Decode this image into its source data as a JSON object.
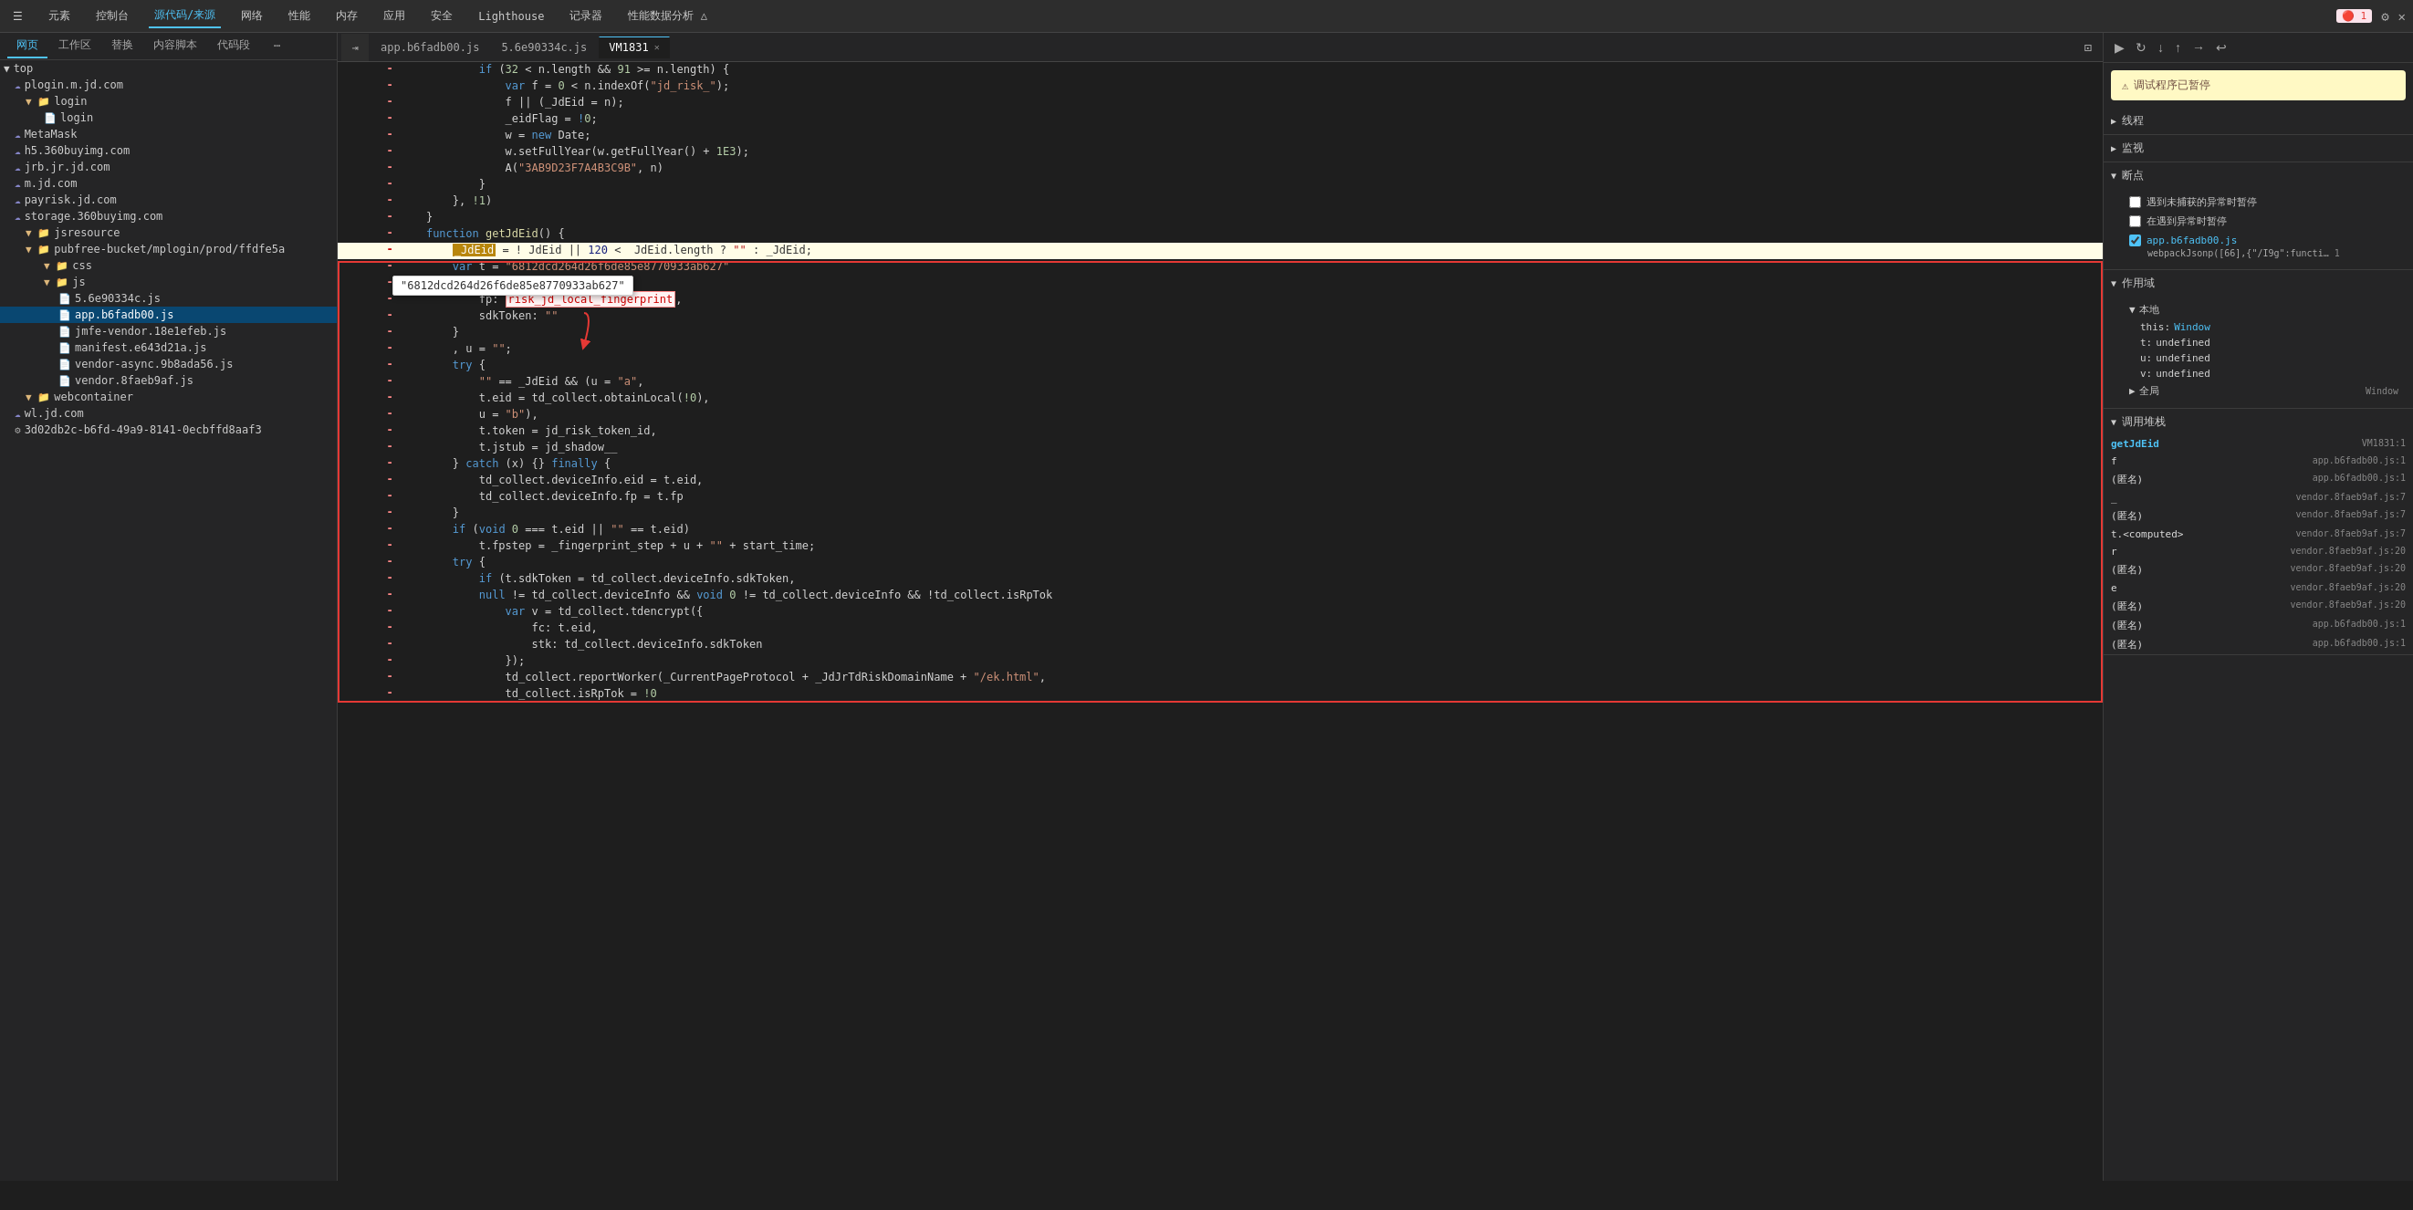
{
  "toolbar": {
    "items": [
      {
        "label": "☰",
        "id": "menu"
      },
      {
        "label": "元素",
        "id": "elements"
      },
      {
        "label": "控制台",
        "id": "console"
      },
      {
        "label": "源代码/来源",
        "id": "sources",
        "active": true
      },
      {
        "label": "网络",
        "id": "network"
      },
      {
        "label": "性能",
        "id": "performance"
      },
      {
        "label": "内存",
        "id": "memory"
      },
      {
        "label": "应用",
        "id": "application"
      },
      {
        "label": "安全",
        "id": "security"
      },
      {
        "label": "Lighthouse",
        "id": "lighthouse"
      },
      {
        "label": "记录器",
        "id": "recorder"
      },
      {
        "label": "性能数据分析 △",
        "id": "perf-insights"
      }
    ],
    "icons": [
      "🔴1",
      "⚙",
      "✕"
    ]
  },
  "subtabs": {
    "items": [
      {
        "label": "网页",
        "active": true
      },
      {
        "label": "工作区"
      },
      {
        "label": "替换"
      },
      {
        "label": "内容脚本"
      },
      {
        "label": "代码段"
      },
      {
        "label": "⋯"
      }
    ]
  },
  "filetabs": [
    {
      "label": "app.b6fadb00.js",
      "active": false,
      "closable": false
    },
    {
      "label": "5.6e90334c.js",
      "active": false,
      "closable": false
    },
    {
      "label": "VM1831",
      "active": true,
      "closable": true
    }
  ],
  "sidebar": {
    "tree": [
      {
        "label": "top",
        "indent": 0,
        "type": "folder-open",
        "selected": false
      },
      {
        "label": "plogin.m.jd.com",
        "indent": 1,
        "type": "cloud",
        "selected": false
      },
      {
        "label": "login",
        "indent": 2,
        "type": "folder-open",
        "selected": false
      },
      {
        "label": "login",
        "indent": 3,
        "type": "file",
        "selected": false
      },
      {
        "label": "MetaMask",
        "indent": 1,
        "type": "cloud",
        "selected": false
      },
      {
        "label": "h5.360buyimg.com",
        "indent": 1,
        "type": "cloud",
        "selected": false
      },
      {
        "label": "jrb.jr.jd.com",
        "indent": 1,
        "type": "cloud",
        "selected": false
      },
      {
        "label": "m.jd.com",
        "indent": 1,
        "type": "cloud",
        "selected": false
      },
      {
        "label": "payrisk.jd.com",
        "indent": 1,
        "type": "cloud",
        "selected": false
      },
      {
        "label": "storage.360buyimg.com",
        "indent": 1,
        "type": "cloud",
        "selected": false
      },
      {
        "label": "jsresource",
        "indent": 2,
        "type": "folder-open",
        "selected": false
      },
      {
        "label": "pubfree-bucket/mplogin/prod/ffdfe5a",
        "indent": 2,
        "type": "folder-open",
        "selected": false
      },
      {
        "label": "css",
        "indent": 3,
        "type": "folder-open",
        "selected": false
      },
      {
        "label": "js",
        "indent": 3,
        "type": "folder-open",
        "selected": false
      },
      {
        "label": "5.6e90334c.js",
        "indent": 4,
        "type": "file-js",
        "selected": false
      },
      {
        "label": "app.b6fadb00.js",
        "indent": 4,
        "type": "file-js",
        "selected": true
      },
      {
        "label": "jmfe-vendor.18e1efeb.js",
        "indent": 4,
        "type": "file-js",
        "selected": false
      },
      {
        "label": "manifest.e643d21a.js",
        "indent": 4,
        "type": "file-js",
        "selected": false
      },
      {
        "label": "vendor-async.9b8ada56.js",
        "indent": 4,
        "type": "file-js",
        "selected": false
      },
      {
        "label": "vendor.8faeb9af.js",
        "indent": 4,
        "type": "file-js",
        "selected": false
      },
      {
        "label": "webcontainer",
        "indent": 2,
        "type": "folder-open",
        "selected": false
      },
      {
        "label": "wl.jd.com",
        "indent": 1,
        "type": "cloud",
        "selected": false
      },
      {
        "label": "3d02db2c-b6fd-49a9-8141-0ecbffd8aaf3",
        "indent": 1,
        "type": "gear",
        "selected": false
      }
    ]
  },
  "code": {
    "lines": [
      {
        "num": "",
        "diff": "-",
        "content": "            if (32 < n.length && 91 >= n.length) {"
      },
      {
        "num": "",
        "diff": "-",
        "content": "                var f = 0 < n.indexOf(\"jd_risk_\");"
      },
      {
        "num": "",
        "diff": "-",
        "content": "                f || (_JdEid = n);"
      },
      {
        "num": "",
        "diff": "-",
        "content": "                _eidFlag = !0;"
      },
      {
        "num": "",
        "diff": "-",
        "content": "                w = new Date;"
      },
      {
        "num": "",
        "diff": "-",
        "content": "                w.setFullYear(w.getFullYear() + 1E3);"
      },
      {
        "num": "",
        "diff": "-",
        "content": "                A(\"3AB9D23F7A4B3C9B\", n)"
      },
      {
        "num": "",
        "diff": "-",
        "content": "            }"
      },
      {
        "num": "",
        "diff": "-",
        "content": "        }, !1)"
      },
      {
        "num": "",
        "diff": "-",
        "content": "    }"
      },
      {
        "num": "",
        "diff": "-",
        "content": "    function getJdEid() {",
        "special": "function-line"
      },
      {
        "num": "",
        "diff": "-",
        "content": "        _JdEid = ! JdEid || 120 <  JdEid.length ? \"\" : _JdEid;",
        "highlighted": true
      },
      {
        "num": "",
        "diff": "-",
        "content": "        var t = \"6812dcd264d26f6de85e8770933ab627\"",
        "tooltip": true
      },
      {
        "num": "",
        "diff": "-",
        "content": "            eio: _JdEid,"
      },
      {
        "num": "",
        "diff": "-",
        "content": "            fp: risk_jd_local_fingerprint,",
        "fp_underline": true
      },
      {
        "num": "",
        "diff": "-",
        "content": "            sdkToken: \"\""
      },
      {
        "num": "",
        "diff": "-",
        "content": "        }"
      },
      {
        "num": "",
        "diff": "-",
        "content": "        , u = \"\";"
      },
      {
        "num": "",
        "diff": "-",
        "content": "        try {"
      },
      {
        "num": "",
        "diff": "-",
        "content": "            \"\" == _JdEid && (u = \"a\","
      },
      {
        "num": "",
        "diff": "-",
        "content": "            t.eid = td_collect.obtainLocal(!0),"
      },
      {
        "num": "",
        "diff": "-",
        "content": "            u = \"b\"),"
      },
      {
        "num": "",
        "diff": "-",
        "content": "            t.token = jd_risk_token_id,"
      },
      {
        "num": "",
        "diff": "-",
        "content": "            t.jstub = jd_shadow__"
      },
      {
        "num": "",
        "diff": "-",
        "content": "        } catch (x) {} finally {"
      },
      {
        "num": "",
        "diff": "-",
        "content": "            td_collect.deviceInfo.eid = t.eid,"
      },
      {
        "num": "",
        "diff": "-",
        "content": "            td_collect.deviceInfo.fp = t.fp"
      },
      {
        "num": "",
        "diff": "-",
        "content": "        }"
      },
      {
        "num": "",
        "diff": "-",
        "content": "        if (void 0 === t.eid || \"\" == t.eid)"
      },
      {
        "num": "",
        "diff": "-",
        "content": "            t.fpstep = _fingerprint_step + u + \"\" + start_time;"
      },
      {
        "num": "",
        "diff": "-",
        "content": "        try {"
      },
      {
        "num": "",
        "diff": "-",
        "content": "            if (t.sdkToken = td_collect.deviceInfo.sdkToken,"
      },
      {
        "num": "",
        "diff": "-",
        "content": "            null != td_collect.deviceInfo && void 0 != td_collect.deviceInfo && !td_collect.isRpTok"
      },
      {
        "num": "",
        "diff": "-",
        "content": "                var v = td_collect.tdencrypt({"
      },
      {
        "num": "",
        "diff": "-",
        "content": "                    fc: t.eid,"
      },
      {
        "num": "",
        "diff": "-",
        "content": "                    stk: td_collect.deviceInfo.sdkToken"
      },
      {
        "num": "",
        "diff": "-",
        "content": "                });"
      },
      {
        "num": "",
        "diff": "-",
        "content": "                td_collect.reportWorker(_CurrentPageProtocol + _JdJrTdRiskDomainName + \"/ek.html\","
      },
      {
        "num": "",
        "diff": "-",
        "content": "                td_collect.isRpTok = !0"
      }
    ]
  },
  "rightpanel": {
    "debug_status": "调试程序已暂停",
    "debug_icon": "⚠",
    "sections": {
      "threads": {
        "label": "线程",
        "collapsed": true
      },
      "watch": {
        "label": "监视",
        "collapsed": true
      },
      "breakpoints": {
        "label": "断点",
        "collapsed": false,
        "options": [
          {
            "label": "遇到未捕获的异常时暂停",
            "checked": false
          },
          {
            "label": "在遇到异常时暂停",
            "checked": false
          }
        ],
        "files": [
          {
            "name": "app.b6fadb00.js",
            "line": "webpackJsonp([66],{\"/I9g\":functi…",
            "linenum": "1"
          }
        ]
      },
      "scope": {
        "label": "作用域",
        "collapsed": false,
        "items": [
          {
            "name": "本地",
            "expanded": true,
            "vars": [
              {
                "key": "this:",
                "val": "Window"
              },
              {
                "key": "t:",
                "val": "undefined"
              },
              {
                "key": "u:",
                "val": "undefined"
              },
              {
                "key": "v:",
                "val": "undefined"
              }
            ]
          },
          {
            "name": "全局",
            "expanded": false,
            "extra": "Window"
          }
        ]
      },
      "callstack": {
        "label": "调用堆栈",
        "collapsed": false,
        "items": [
          {
            "name": "getJdEid",
            "file": "VM1831:1",
            "active": true
          },
          {
            "name": "f",
            "file": "app.b6fadb00.js:1"
          },
          {
            "name": "(匿名)",
            "file": "app.b6fadb00.js:1"
          },
          {
            "name": "_",
            "file": "vendor.8faeb9af.js:7"
          },
          {
            "name": "(匿名)",
            "file": "vendor.8faeb9af.js:7"
          },
          {
            "name": "t.<computed>",
            "file": "vendor.8faeb9af.js:7"
          },
          {
            "name": "r",
            "file": "vendor.8faeb9af.js:20"
          },
          {
            "name": "(匿名)",
            "file": "vendor.8faeb9af.js:20"
          },
          {
            "name": "e",
            "file": "vendor.8faeb9af.js:20"
          },
          {
            "name": "(匿名)",
            "file": "vendor.8faeb9af.js:20"
          },
          {
            "name": "(匿名)",
            "file": "app.b6fadb00.js:1"
          },
          {
            "name": "(匿名)",
            "file": "app.b6fadb00.js:1"
          }
        ]
      }
    }
  },
  "tooltip": {
    "text": "\"6812dcd264d26f6de85e8770933ab627\""
  }
}
